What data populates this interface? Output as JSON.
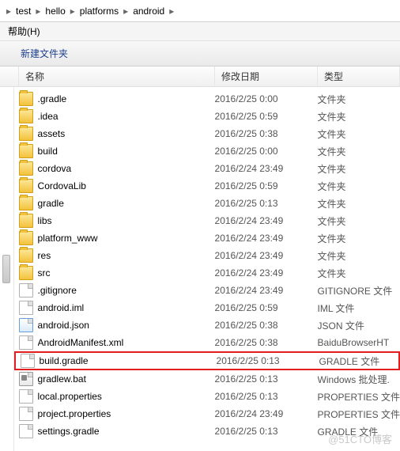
{
  "breadcrumb": [
    "test",
    "hello",
    "platforms",
    "android"
  ],
  "menu": {
    "help": "帮助(H)"
  },
  "toolbar": {
    "new_folder": "新建文件夹"
  },
  "columns": {
    "name": "名称",
    "date": "修改日期",
    "type": "类型"
  },
  "files": [
    {
      "name": ".gradle",
      "date": "2016/2/25 0:00",
      "type": "文件夹",
      "icon": "folder",
      "hl": false
    },
    {
      "name": ".idea",
      "date": "2016/2/25 0:59",
      "type": "文件夹",
      "icon": "folder",
      "hl": false
    },
    {
      "name": "assets",
      "date": "2016/2/25 0:38",
      "type": "文件夹",
      "icon": "folder",
      "hl": false
    },
    {
      "name": "build",
      "date": "2016/2/25 0:00",
      "type": "文件夹",
      "icon": "folder",
      "hl": false
    },
    {
      "name": "cordova",
      "date": "2016/2/24 23:49",
      "type": "文件夹",
      "icon": "folder",
      "hl": false
    },
    {
      "name": "CordovaLib",
      "date": "2016/2/25 0:59",
      "type": "文件夹",
      "icon": "folder",
      "hl": false
    },
    {
      "name": "gradle",
      "date": "2016/2/25 0:13",
      "type": "文件夹",
      "icon": "folder",
      "hl": false
    },
    {
      "name": "libs",
      "date": "2016/2/24 23:49",
      "type": "文件夹",
      "icon": "folder",
      "hl": false
    },
    {
      "name": "platform_www",
      "date": "2016/2/24 23:49",
      "type": "文件夹",
      "icon": "folder",
      "hl": false
    },
    {
      "name": "res",
      "date": "2016/2/24 23:49",
      "type": "文件夹",
      "icon": "folder",
      "hl": false
    },
    {
      "name": "src",
      "date": "2016/2/24 23:49",
      "type": "文件夹",
      "icon": "folder",
      "hl": false
    },
    {
      "name": ".gitignore",
      "date": "2016/2/24 23:49",
      "type": "GITIGNORE 文件",
      "icon": "file",
      "hl": false
    },
    {
      "name": "android.iml",
      "date": "2016/2/25 0:59",
      "type": "IML 文件",
      "icon": "file",
      "hl": false
    },
    {
      "name": "android.json",
      "date": "2016/2/25 0:38",
      "type": "JSON 文件",
      "icon": "json",
      "hl": false
    },
    {
      "name": "AndroidManifest.xml",
      "date": "2016/2/25 0:38",
      "type": "BaiduBrowserHT",
      "icon": "file",
      "hl": false
    },
    {
      "name": "build.gradle",
      "date": "2016/2/25 0:13",
      "type": "GRADLE 文件",
      "icon": "file",
      "hl": true
    },
    {
      "name": "gradlew.bat",
      "date": "2016/2/25 0:13",
      "type": "Windows 批处理.",
      "icon": "bat",
      "hl": false
    },
    {
      "name": "local.properties",
      "date": "2016/2/25 0:13",
      "type": "PROPERTIES 文件",
      "icon": "file",
      "hl": false
    },
    {
      "name": "project.properties",
      "date": "2016/2/24 23:49",
      "type": "PROPERTIES 文件",
      "icon": "file",
      "hl": false
    },
    {
      "name": "settings.gradle",
      "date": "2016/2/25 0:13",
      "type": "GRADLE 文件",
      "icon": "file",
      "hl": false
    }
  ],
  "watermark": "@51CTO博客"
}
